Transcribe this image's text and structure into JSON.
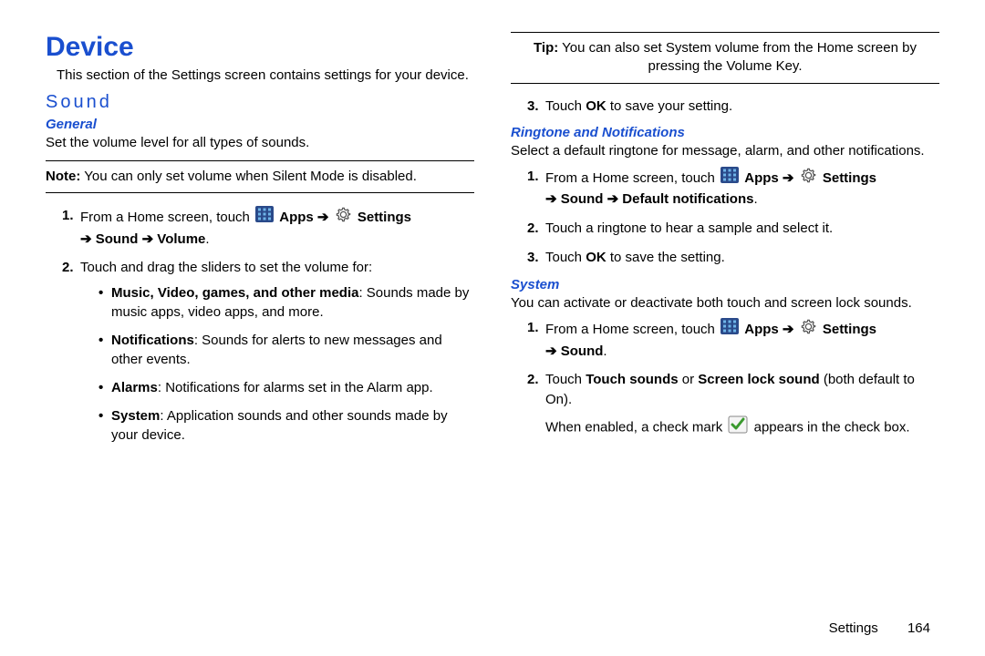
{
  "col1": {
    "heading": "Device",
    "intro": "This section of the Settings screen contains settings for your device.",
    "sound_heading": "Sound",
    "general_heading": "General",
    "general_desc": "Set the volume level for all types of sounds.",
    "note_label": "Note:",
    "note_text": " You can only set volume when Silent Mode is disabled.",
    "step1_pre": "From a Home screen, touch ",
    "apps": " Apps",
    "settings": " Settings",
    "nav_sound_volume": "Sound ➔ Volume",
    "step2": "Touch and drag the sliders to set the volume for:",
    "bullet1_b": "Music, Video, games, and other media",
    "bullet1_r": ": Sounds made by music apps, video apps, and more.",
    "bullet2_b": "Notifications",
    "bullet2_r": ": Sounds for alerts to new messages and other events.",
    "bullet3_b": "Alarms",
    "bullet3_r": ": Notifications for alarms set in the Alarm app.",
    "bullet4_b": "System",
    "bullet4_r": ": Application sounds and other sounds made by your device."
  },
  "col2": {
    "tip_label": "Tip:",
    "tip_text": " You can also set System volume from the Home screen by pressing the Volume Key.",
    "g_step3_a": "Touch ",
    "g_step3_b": "OK",
    "g_step3_c": " to save your setting.",
    "ring_heading": "Ringtone and Notifications",
    "ring_desc": "Select a default ringtone for message, alarm, and other notifications.",
    "r_step1_pre": "From a Home screen, touch ",
    "apps": " Apps",
    "settings": " Settings",
    "nav_sound_default": "Sound ➔ Default notifications",
    "r_step2": "Touch a ringtone to hear a sample and select it.",
    "r_step3_a": "Touch ",
    "r_step3_b": "OK",
    "r_step3_c": " to save the setting.",
    "sys_heading": "System",
    "sys_desc": "You can activate or deactivate both touch and screen lock sounds.",
    "s_step1_pre": "From a Home screen, touch ",
    "nav_sound": "Sound",
    "s_step2_a": "Touch ",
    "s_step2_b": "Touch sounds",
    "s_step2_c": " or ",
    "s_step2_d": "Screen lock sound",
    "s_step2_e": " (both default to On).",
    "s_step2_note_a": "When enabled, a check mark ",
    "s_step2_note_b": " appears in the check box."
  },
  "footer": {
    "section": "Settings",
    "page": "164"
  },
  "glyphs": {
    "arrow": "➔",
    "period": "."
  }
}
